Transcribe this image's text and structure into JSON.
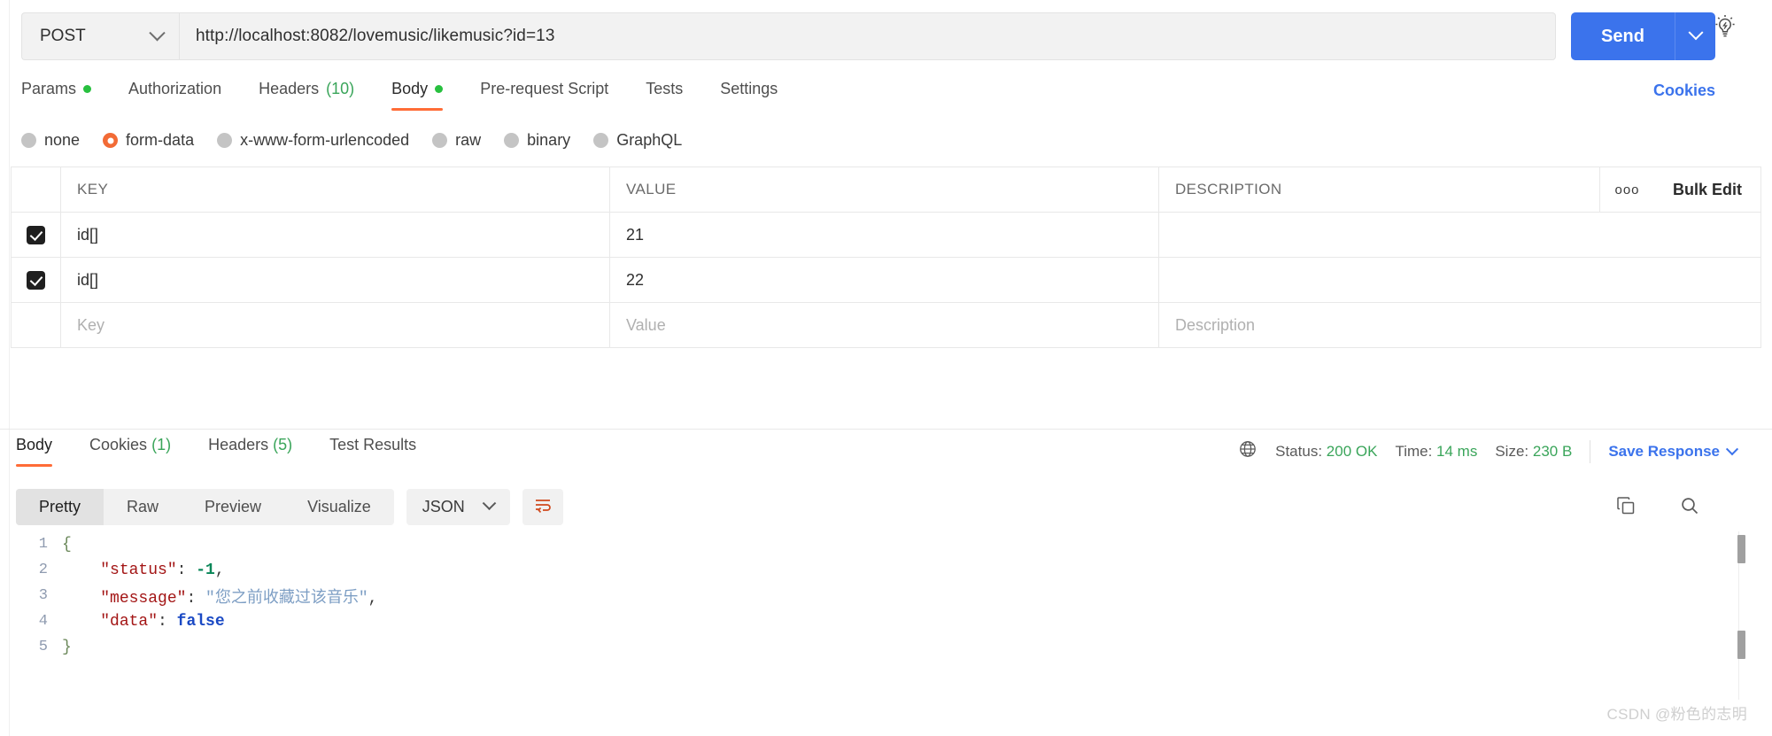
{
  "request": {
    "method": "POST",
    "url": "http://localhost:8082/lovemusic/likemusic?id=13",
    "send_label": "Send",
    "cookies_label": "Cookies",
    "bulb_icon": "lightbulb-icon",
    "tabs": [
      {
        "label": "Params",
        "has_dot": true
      },
      {
        "label": "Authorization",
        "has_dot": false
      },
      {
        "label": "Headers",
        "count": "(10)",
        "has_dot": false
      },
      {
        "label": "Body",
        "has_dot": true,
        "active": true
      },
      {
        "label": "Pre-request Script",
        "has_dot": false
      },
      {
        "label": "Tests",
        "has_dot": false
      },
      {
        "label": "Settings",
        "has_dot": false
      }
    ],
    "body_types": [
      {
        "label": "none",
        "selected": false
      },
      {
        "label": "form-data",
        "selected": true
      },
      {
        "label": "x-www-form-urlencoded",
        "selected": false
      },
      {
        "label": "raw",
        "selected": false
      },
      {
        "label": "binary",
        "selected": false
      },
      {
        "label": "GraphQL",
        "selected": false
      }
    ],
    "table": {
      "headers": {
        "key": "KEY",
        "value": "VALUE",
        "description": "DESCRIPTION"
      },
      "dots_icon": "ooo",
      "bulk_edit_label": "Bulk Edit",
      "rows": [
        {
          "checked": true,
          "key": "id[]",
          "value": "21",
          "description": ""
        },
        {
          "checked": true,
          "key": "id[]",
          "value": "22",
          "description": ""
        }
      ],
      "placeholder_row": {
        "key": "Key",
        "value": "Value",
        "description": "Description"
      }
    }
  },
  "response": {
    "tabs": [
      {
        "label": "Body",
        "active": true
      },
      {
        "label": "Cookies",
        "count": "(1)"
      },
      {
        "label": "Headers",
        "count": "(5)"
      },
      {
        "label": "Test Results"
      }
    ],
    "status": {
      "globe_icon": "globe-icon",
      "status_label": "Status:",
      "status_value": "200 OK",
      "time_label": "Time:",
      "time_value": "14 ms",
      "size_label": "Size:",
      "size_value": "230 B",
      "save_label": "Save Response"
    },
    "toolbar": {
      "views": [
        {
          "label": "Pretty",
          "active": true
        },
        {
          "label": "Raw"
        },
        {
          "label": "Preview"
        },
        {
          "label": "Visualize"
        }
      ],
      "format": "JSON",
      "wrap_icon": "word-wrap-icon",
      "copy_icon": "copy-icon",
      "search_icon": "search-icon"
    },
    "body_lines": [
      {
        "num": "1",
        "fold": "{",
        "content": ""
      },
      {
        "num": "2",
        "fold": "",
        "key": "\"status\"",
        "sep": ": ",
        "val": "-1",
        "val_type": "num",
        "tail": ","
      },
      {
        "num": "3",
        "fold": "",
        "key": "\"message\"",
        "sep": ": ",
        "val": "\"您之前收藏过该音乐\"",
        "val_type": "str",
        "tail": ","
      },
      {
        "num": "4",
        "fold": "",
        "key": "\"data\"",
        "sep": ": ",
        "val": "false",
        "val_type": "bool",
        "tail": ""
      },
      {
        "num": "5",
        "fold": "}",
        "content": ""
      }
    ]
  },
  "watermark": "CSDN @粉色的志明",
  "colors": {
    "accent_orange": "#ff6c37",
    "primary_blue": "#3b73ec",
    "status_green": "#3aa55a",
    "form_data_radio": "#f26b36"
  }
}
